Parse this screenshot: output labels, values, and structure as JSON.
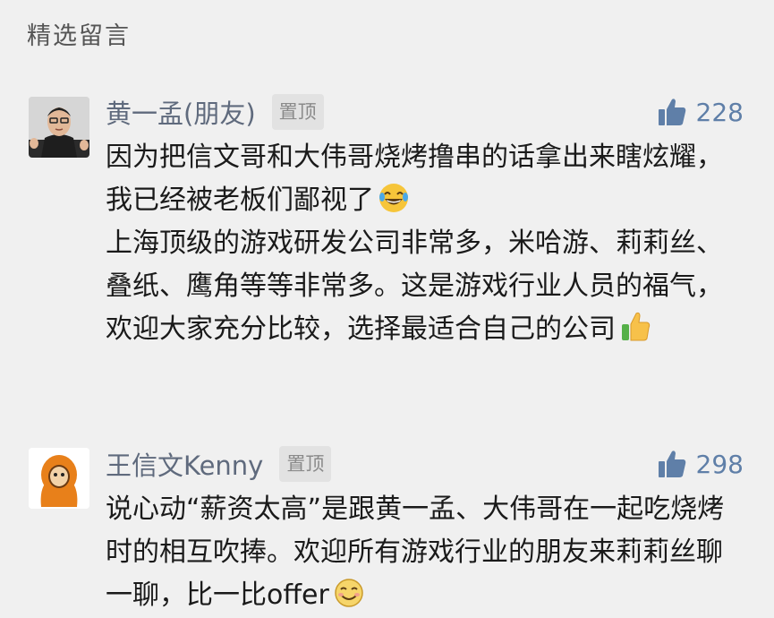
{
  "section": {
    "title": "精选留言"
  },
  "comments": [
    {
      "name": "黄一孟(朋友)",
      "badge": "置顶",
      "likes": "228",
      "paragraphs": [
        "因为把信文哥和大伟哥烧烤撸串的话拿出来瞎炫耀，我已经被老板们鄙视了",
        "上海顶级的游戏研发公司非常多，米哈游、莉莉丝、叠纸、鹰角等等非常多。这是游戏行业人员的福气，欢迎大家充分比较，选择最适合自己的公司"
      ],
      "emojis": [
        "laughing-tears-emoji",
        "thumbs-up-emoji"
      ]
    },
    {
      "name": "王信文Kenny",
      "badge": "置顶",
      "likes": "298",
      "paragraphs": [
        "说心动“薪资太高”是跟黄一孟、大伟哥在一起吃烧烤时的相互吹捧。欢迎所有游戏行业的朋友来莉莉丝聊一聊，比一比offer"
      ],
      "emojis": [
        "smile-emoji"
      ]
    }
  ],
  "colors": {
    "background": "#f0f0f0",
    "name": "#5f6a7d",
    "like": "#5f7fa8",
    "text": "#1a1a1a"
  }
}
